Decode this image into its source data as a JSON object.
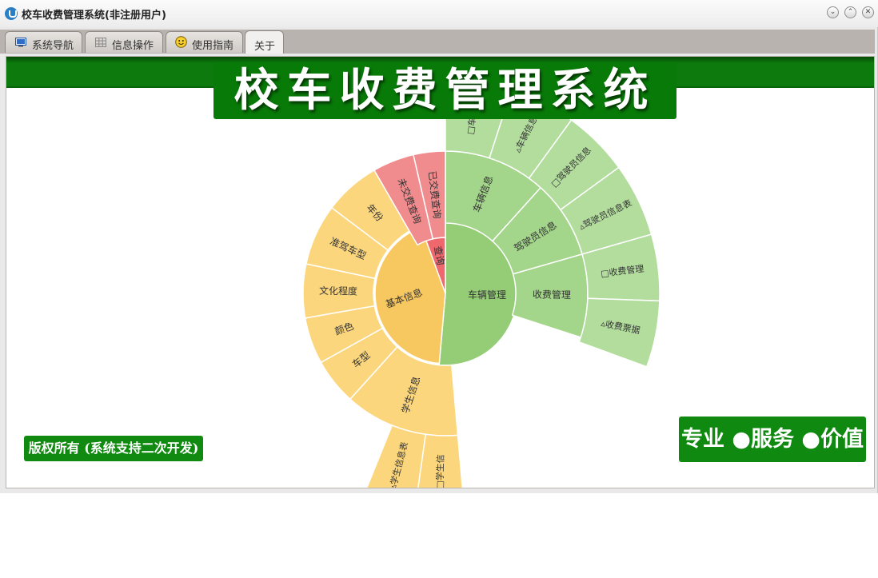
{
  "window": {
    "title": "校车收费管理系统(非注册用户)",
    "controls": {
      "minimize": "⌄",
      "maximize": "⌃",
      "close": "✕"
    }
  },
  "tabs": [
    {
      "label": "系统导航",
      "icon": "monitor-icon"
    },
    {
      "label": "信息操作",
      "icon": "grid-icon"
    },
    {
      "label": "使用指南",
      "icon": "smiley-icon"
    },
    {
      "label": "关于",
      "icon": "",
      "active": true
    }
  ],
  "about": {
    "title": "校车收费管理系统",
    "copyright": "版权所有 (系统支持二次开发)",
    "slogan": "专业 ●服务 ●价值"
  },
  "colors": {
    "brand_green": "#0c7a0c",
    "vehicle_green": "#95cd77",
    "vehicle_light": "#b2dd9d",
    "query_red": "#ee686e",
    "query_light": "#f08c8e",
    "basic_yellow": "#f8c860",
    "basic_light": "#fbd67d"
  },
  "sunburst": {
    "root": [
      {
        "name": "车辆管理",
        "group": "vehicle"
      },
      {
        "name": "基本信息",
        "group": "basic"
      },
      {
        "name": "查询",
        "group": "query"
      }
    ],
    "ring2": [
      {
        "name": "车辆信息",
        "group": "vehicle"
      },
      {
        "name": "驾驶员信息",
        "group": "vehicle"
      },
      {
        "name": "收费管理",
        "group": "vehicle"
      },
      {
        "name": "学生信息",
        "group": "basic"
      },
      {
        "name": "车型",
        "group": "basic"
      },
      {
        "name": "颜色",
        "group": "basic"
      },
      {
        "name": "文化程度",
        "group": "basic"
      },
      {
        "name": "准驾车型",
        "group": "basic"
      },
      {
        "name": "年份",
        "group": "basic"
      },
      {
        "name": "未交费查询",
        "group": "query"
      },
      {
        "name": "已交费查询",
        "group": "query"
      }
    ],
    "ring3": [
      {
        "name": "□车辆信",
        "group": "vehicle"
      },
      {
        "name": "▵车辆信息",
        "group": "vehicle"
      },
      {
        "name": "□驾驶员信息",
        "group": "vehicle"
      },
      {
        "name": "▵驾驶员信息表",
        "group": "vehicle"
      },
      {
        "name": "□收费管理",
        "group": "vehicle"
      },
      {
        "name": "▵收费票据",
        "group": "vehicle"
      },
      {
        "name": "□学生信",
        "group": "basic"
      },
      {
        "name": "▵学生信息表",
        "group": "basic"
      }
    ]
  }
}
